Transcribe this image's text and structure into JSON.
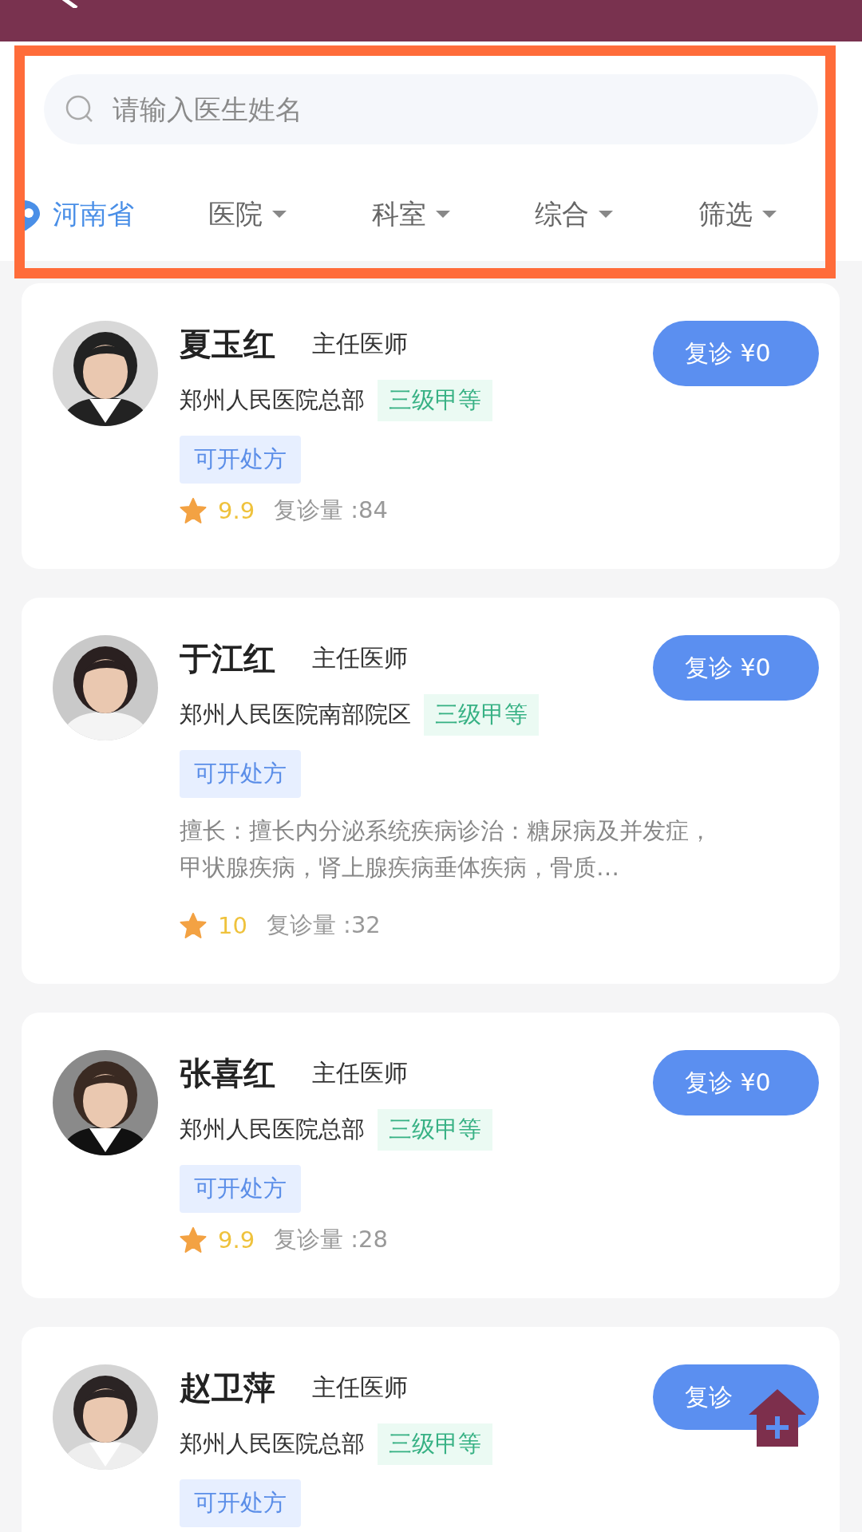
{
  "search": {
    "placeholder": "请输入医生姓名"
  },
  "filters": [
    {
      "label": "河南省",
      "kind": "location"
    },
    {
      "label": "医院",
      "kind": "dropdown"
    },
    {
      "label": "科室",
      "kind": "dropdown"
    },
    {
      "label": "综合",
      "kind": "dropdown"
    },
    {
      "label": "筛选",
      "kind": "dropdown"
    }
  ],
  "doctors": [
    {
      "name": "夏玉红",
      "title": "主任医师",
      "hospital": "郑州人民医院总部",
      "grade": "三级甲等",
      "tag": "可开处方",
      "rating": "9.9",
      "visits": "复诊量 :84",
      "button": "复诊 ¥0"
    },
    {
      "name": "于江红",
      "title": "主任医师",
      "hospital": "郑州人民医院南部院区",
      "grade": "三级甲等",
      "tag": "可开处方",
      "specialty": "擅长：擅长内分泌系统疾病诊治：糖尿病及并发症，甲状腺疾病，肾上腺疾病垂体疾病，骨质…",
      "rating": "10",
      "visits": "复诊量 :32",
      "button": "复诊 ¥0"
    },
    {
      "name": "张喜红",
      "title": "主任医师",
      "hospital": "郑州人民医院总部",
      "grade": "三级甲等",
      "tag": "可开处方",
      "rating": "9.9",
      "visits": "复诊量 :28",
      "button": "复诊 ¥0"
    },
    {
      "name": "赵卫萍",
      "title": "主任医师",
      "hospital": "郑州人民医院总部",
      "grade": "三级甲等",
      "tag": "可开处方",
      "button": "复诊"
    }
  ]
}
